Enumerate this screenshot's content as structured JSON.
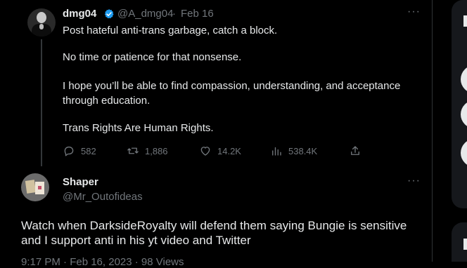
{
  "tweet": {
    "author_name": "dmg04",
    "author_handle": "@A_dmg04",
    "separator": "·",
    "date": "Feb 16",
    "more_icon": "more-horizontal-icon",
    "lines": [
      "Post hateful anti-trans garbage, catch a block.",
      "No time or patience for that nonsense.",
      "I hope you’ll be able to find compassion, understanding, and acceptance",
      "through education.",
      "Trans Rights Are Human Rights."
    ],
    "stats": {
      "replies": "582",
      "retweets": "1,886",
      "likes": "14.2K",
      "views": "538.4K"
    }
  },
  "reply": {
    "author_name": "Shaper",
    "author_handle": "@Mr_Outofideas",
    "more_icon": "more-horizontal-icon",
    "lines": [
      "Watch when DarksideRoyalty will defend them saying Bungie is sensitive",
      "and I support anti in his yt video and Twitter"
    ],
    "meta": "9:17 PM · Feb 16, 2023 · 98 Views"
  },
  "colors": {
    "background": "#000000",
    "text": "#e7e9ea",
    "secondary": "#71767b",
    "verified": "#1d9bf0",
    "divider": "#2f3336"
  }
}
